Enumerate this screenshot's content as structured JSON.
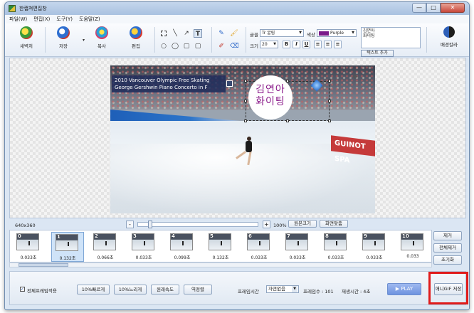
{
  "window": {
    "title": "한캡쳐편집창",
    "min_glyph": "—",
    "max_glyph": "□",
    "close_glyph": "✕"
  },
  "menu": [
    "파일(W)",
    "편집(X)",
    "도구(Y)",
    "도움말(Z)"
  ],
  "toolbar": {
    "new_label": "새벽처",
    "save_label": "저장",
    "copy_label": "복사",
    "edit_label": "편집",
    "bg_color_label": "배경칼라",
    "dropdown_glyph": "▾"
  },
  "shape_tools": {
    "line": "╲",
    "arrow": "↗",
    "text": "T",
    "ellipse": "○",
    "circle": "◯",
    "rect": "▢",
    "rounded": "▢"
  },
  "draw_tools": {
    "pen": "✎",
    "brush": "🖌",
    "fill": "✐",
    "eraser": "⌫"
  },
  "text_panel": {
    "font_label": "글꼴",
    "font_value": "Tr 굴림",
    "color_label": "색상",
    "color_value": "Purple",
    "color_hex": "#7a1a8a",
    "size_label": "크기",
    "size_value": "20",
    "text_value": "김연아\n화이팅",
    "add_text_button": "텍스트 추가",
    "bold": "B",
    "italic": "I",
    "underline": "U"
  },
  "video": {
    "caption": "2010 Vancouver Olympic Free Skating\nGeorge Gershwin Piano Concerto in F",
    "overlay_text": "김연아\n화이팅",
    "banner": "GUINOT SPA"
  },
  "zoom": {
    "size_label": "640x360",
    "percent": "100%",
    "original_size_button": "원본크기",
    "fit_button": "화면맞춤",
    "minus": "-",
    "plus": "+"
  },
  "frames": [
    {
      "num": "0",
      "time": "0.033초"
    },
    {
      "num": "1",
      "time": "0.132초"
    },
    {
      "num": "2",
      "time": "0.066초"
    },
    {
      "num": "3",
      "time": "0.033초"
    },
    {
      "num": "4",
      "time": "0.099초"
    },
    {
      "num": "5",
      "time": "0.132초"
    },
    {
      "num": "6",
      "time": "0.033초"
    },
    {
      "num": "7",
      "time": "0.033초"
    },
    {
      "num": "8",
      "time": "0.033초"
    },
    {
      "num": "9",
      "time": "0.033초"
    },
    {
      "num": "10",
      "time": "0.033"
    }
  ],
  "side_buttons": {
    "remove": "제거",
    "remove_all": "전체제거",
    "reset": "초기화"
  },
  "bottom": {
    "apply_all_label": "전체프레임적용",
    "faster_button": "10%빠르게",
    "slower_button": "10%느리게",
    "original_speed_button": "원래속도",
    "reverse_button": "역정렬",
    "frame_time_label": "프레임시간",
    "frame_time_value": "자연없음",
    "frame_count_text": "프레임수 : 101",
    "play_time_text": "재생시간 : 4초",
    "play_button": "▶ PLAY",
    "save_gif_button": "애니GIF 저장"
  }
}
